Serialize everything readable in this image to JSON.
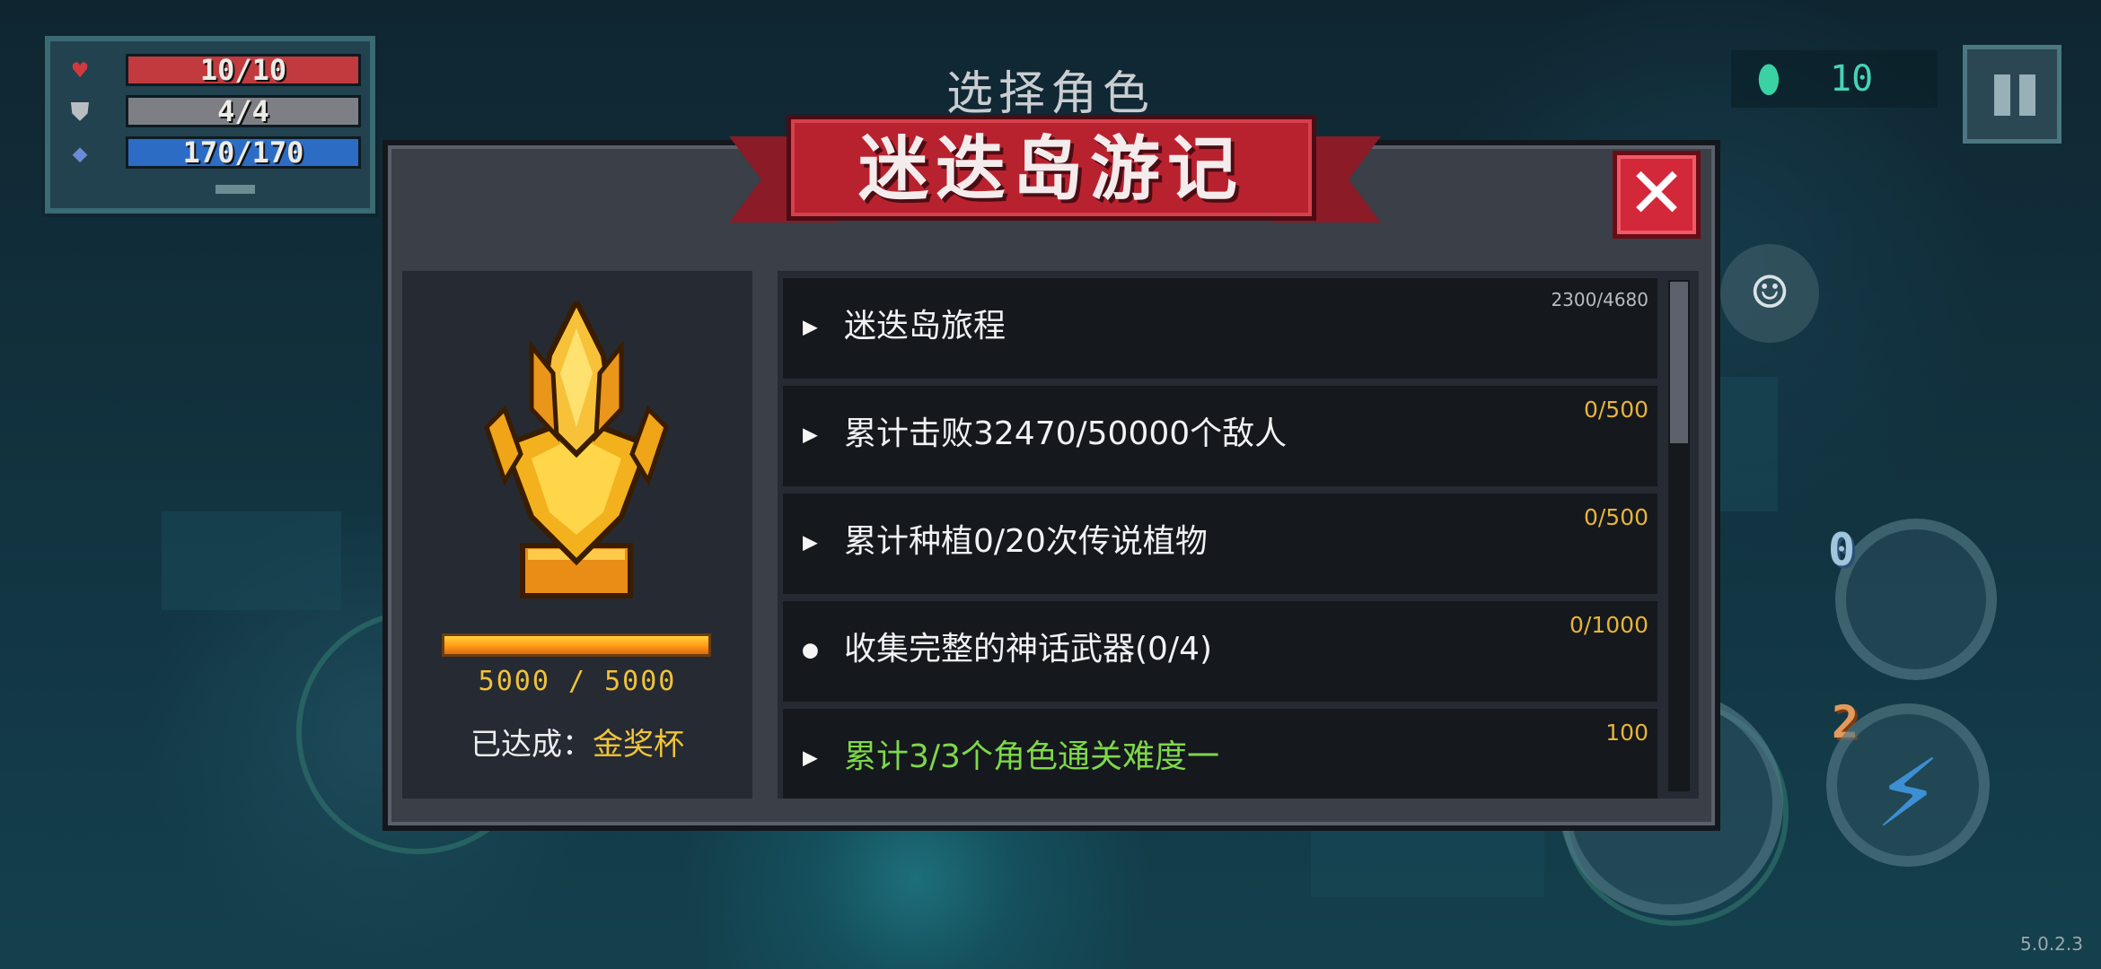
{
  "hud": {
    "hp": {
      "value": "10/10",
      "fill": 1.0,
      "color": "#c13a3e"
    },
    "armor": {
      "value": "4/4",
      "fill": 1.0,
      "color": "#7d7f84"
    },
    "energy": {
      "value": "170/170",
      "fill": 1.0,
      "color": "#2d6cc4"
    },
    "icons": [
      "heart-icon",
      "shield-icon",
      "diamond-icon"
    ]
  },
  "screen_title": "选择角色",
  "currency": {
    "icon": "gem-icon",
    "value": "10"
  },
  "dialog": {
    "title": "迷迭岛游记",
    "close_label": "✕",
    "trophy": {
      "icon": "golden-trophy-icon",
      "progress_text": "5000 / 5000",
      "progress_fraction": 1.0,
      "achieved_label": "已达成：",
      "achieved_value": "金奖杯"
    },
    "quests": [
      {
        "marker": "▶",
        "text": "迷迭岛旅程",
        "reward": "2300/4680",
        "completed": false
      },
      {
        "marker": "▶",
        "text": "累计击败32470/50000个敌人",
        "reward": "0/500",
        "completed": false
      },
      {
        "marker": "▶",
        "text": "累计种植0/20次传说植物",
        "reward": "0/500",
        "completed": false
      },
      {
        "marker": "●",
        "text": "收集完整的神话武器(0/4)",
        "reward": "0/1000",
        "completed": false
      },
      {
        "marker": "▶",
        "text": "累计3/3个角色通关难度一",
        "reward": "100",
        "completed": true
      }
    ]
  },
  "controls": {
    "emote_icon": "smiley-icon",
    "skill_icon": "lightning-icon",
    "weapon_slot_1": "0",
    "weapon_slot_2": "2",
    "pause_icon": "pause-icon"
  },
  "version": "5.0.2.3",
  "colors": {
    "accent_red": "#b8222f",
    "gold": "#f1c43a",
    "green_done": "#7ed84a"
  }
}
